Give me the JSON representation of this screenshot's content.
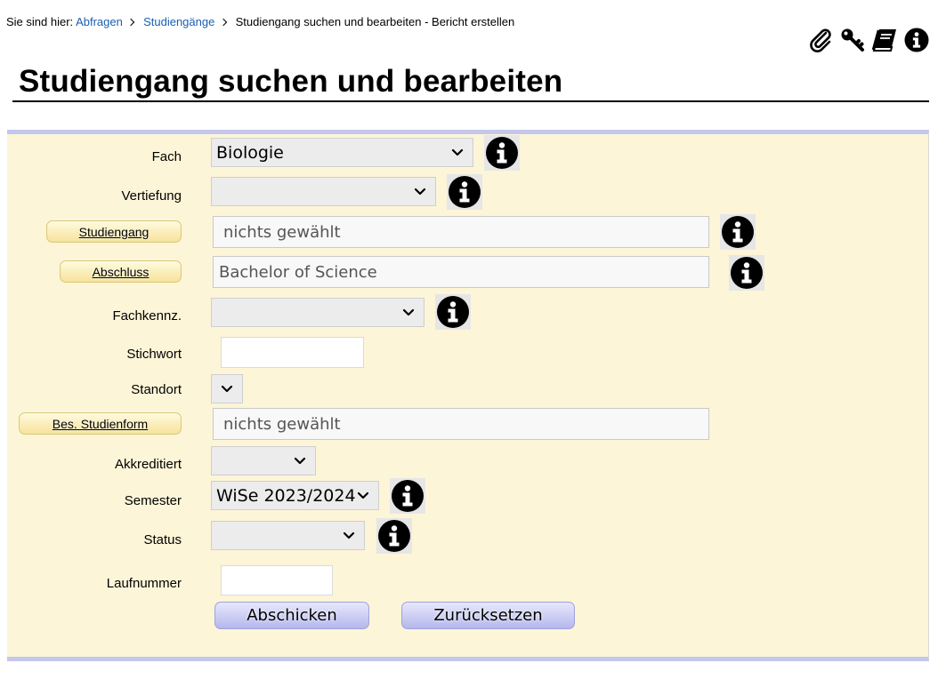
{
  "breadcrumb": {
    "prefix": "Sie sind hier:",
    "items": [
      "Abfragen",
      "Studiengänge"
    ],
    "current": "Studiengang suchen und bearbeiten - Bericht erstellen"
  },
  "top_icons": [
    "paperclip-icon",
    "key-icon",
    "book-icon",
    "info-icon"
  ],
  "page_title": "Studiengang suchen und bearbeiten",
  "colors": {
    "panel_bg": "#fdf5d8",
    "panel_border": "#c3c7ec",
    "link": "#1a5fb4",
    "label_button": "#f6e29a",
    "action_button": "#b5b7ec"
  },
  "form": {
    "fach": {
      "label": "Fach",
      "value": "Biologie"
    },
    "vertiefung": {
      "label": "Vertiefung",
      "value": ""
    },
    "studiengang": {
      "label": "Studiengang",
      "value": "nichts gewählt"
    },
    "abschluss": {
      "label": "Abschluss",
      "value": "Bachelor of Science"
    },
    "fachkennz": {
      "label": "Fachkennz.",
      "value": ""
    },
    "stichwort": {
      "label": "Stichwort",
      "value": ""
    },
    "standort": {
      "label": "Standort",
      "value": ""
    },
    "bes_studienform": {
      "label": "Bes. Studienform",
      "value": "nichts gewählt"
    },
    "akkreditiert": {
      "label": "Akkreditiert",
      "value": ""
    },
    "semester": {
      "label": "Semester",
      "value": "WiSe 2023/2024"
    },
    "status": {
      "label": "Status",
      "value": ""
    },
    "laufnummer": {
      "label": "Laufnummer",
      "value": ""
    }
  },
  "actions": {
    "submit": "Abschicken",
    "reset": "Zurücksetzen"
  }
}
